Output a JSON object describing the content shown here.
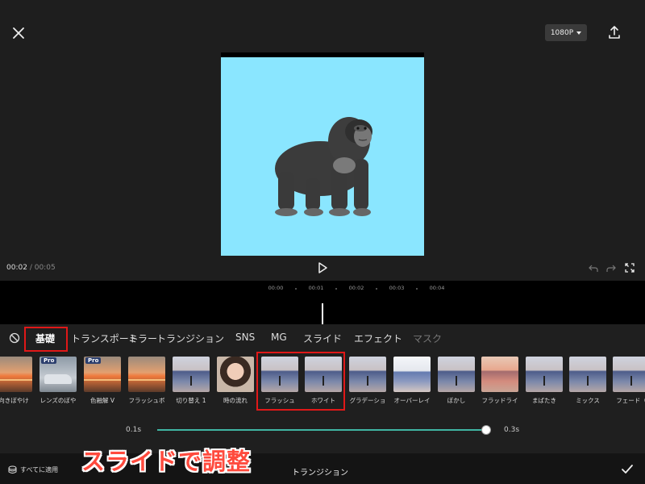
{
  "header": {
    "resolution_label": "1080P",
    "close_icon": "close-icon",
    "export_icon": "export-icon"
  },
  "player": {
    "current_time": "00:02",
    "separator": "/",
    "total_time": "00:05"
  },
  "timeline": {
    "ruler_labels": [
      "00:00",
      "00:01",
      "00:02",
      "00:03",
      "00:04"
    ]
  },
  "transitions": {
    "tabs": [
      {
        "label": "基礎",
        "active": true
      },
      {
        "label": "トランスポート",
        "active": false
      },
      {
        "label": "ミラー",
        "active": false
      },
      {
        "label": "トランジション",
        "active": false
      },
      {
        "label": "SNS",
        "active": false
      },
      {
        "label": "MG",
        "active": false
      },
      {
        "label": "スライド",
        "active": false
      },
      {
        "label": "エフェクト",
        "active": false
      },
      {
        "label": "マスク",
        "active": false
      }
    ],
    "effects": [
      {
        "label": "向きぼやけ",
        "thumb": "sunset",
        "pro": false
      },
      {
        "label": "レンズのぼや",
        "thumb": "car",
        "pro": true
      },
      {
        "label": "色融解 V",
        "thumb": "sunset",
        "pro": true
      },
      {
        "label": "フラッシュボ",
        "thumb": "sunset",
        "pro": false
      },
      {
        "label": "切り替え 1",
        "thumb": "lake",
        "pro": false
      },
      {
        "label": "時の流れ",
        "thumb": "portrait",
        "pro": false
      },
      {
        "label": "フラッシュ",
        "thumb": "lake",
        "pro": false
      },
      {
        "label": "ホワイト",
        "thumb": "lake",
        "pro": false
      },
      {
        "label": "グラデーショ",
        "thumb": "lake",
        "pro": false
      },
      {
        "label": "オーバーレイ",
        "thumb": "bright",
        "pro": false
      },
      {
        "label": "ぼかし",
        "thumb": "lake",
        "pro": false
      },
      {
        "label": "フラッドライ",
        "thumb": "warm",
        "pro": false
      },
      {
        "label": "まばたき",
        "thumb": "lake",
        "pro": false
      },
      {
        "label": "ミックス",
        "thumb": "lake",
        "pro": false
      },
      {
        "label": "フェード（",
        "thumb": "lake",
        "pro": false
      }
    ],
    "pro_badge": "Pro",
    "duration": {
      "min_label": "0.1s",
      "max_label": "0.3s",
      "value_fraction": 1.0
    }
  },
  "bottom_bar": {
    "apply_all_label": "すべてに適用",
    "title": "トランジション",
    "confirm_icon": "check-icon"
  },
  "overlay_caption": "スライドで調整",
  "colors": {
    "accent": "#3fb5a3",
    "highlight": "#e01818",
    "canvas_bg": "#8ae6ff",
    "caption": "#ff4a3d"
  }
}
